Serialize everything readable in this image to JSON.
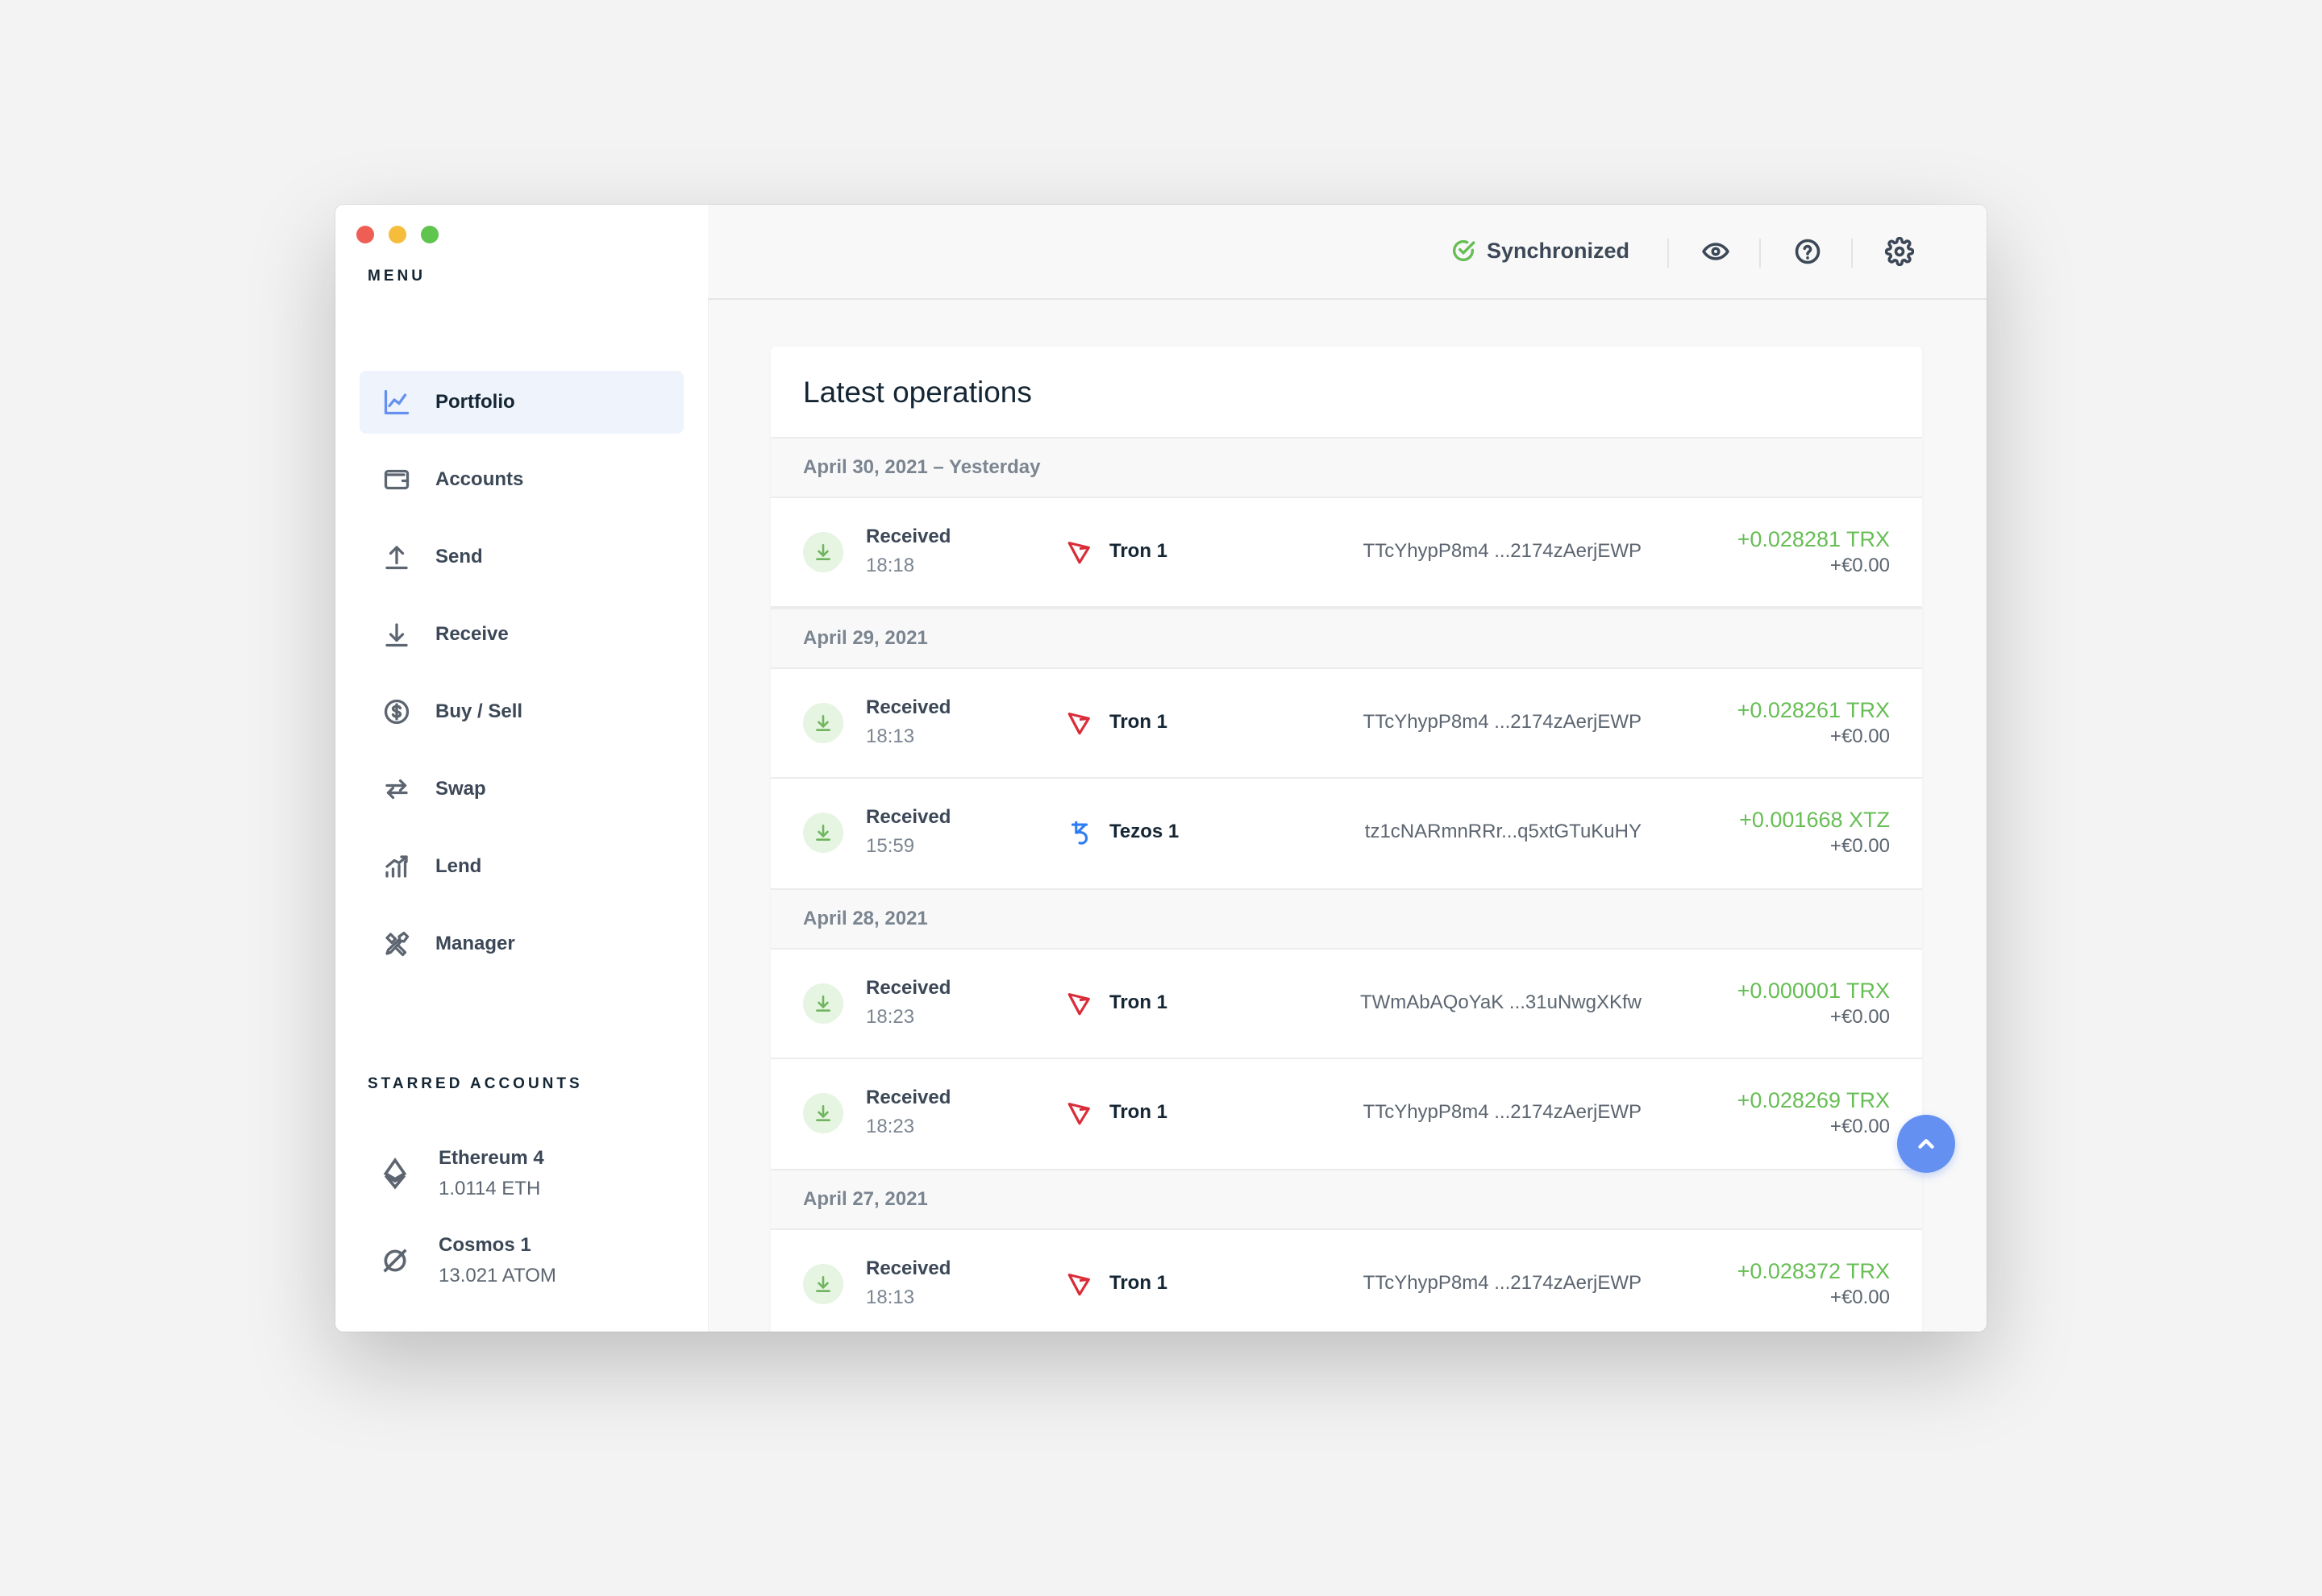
{
  "sidebar": {
    "menu_title": "MENU",
    "items": [
      {
        "label": "Portfolio",
        "icon": "chart-line-icon",
        "active": true
      },
      {
        "label": "Accounts",
        "icon": "wallet-icon"
      },
      {
        "label": "Send",
        "icon": "arrow-up-icon"
      },
      {
        "label": "Receive",
        "icon": "arrow-down-icon"
      },
      {
        "label": "Buy / Sell",
        "icon": "dollar-circle-icon"
      },
      {
        "label": "Swap",
        "icon": "swap-arrows-icon"
      },
      {
        "label": "Lend",
        "icon": "lend-chart-icon"
      },
      {
        "label": "Manager",
        "icon": "tools-icon"
      }
    ],
    "starred_title": "STARRED ACCOUNTS",
    "starred": [
      {
        "name": "Ethereum 4",
        "balance": "1.0114 ETH",
        "icon": "ethereum-icon"
      },
      {
        "name": "Cosmos 1",
        "balance": "13.021 ATOM",
        "icon": "cosmos-icon"
      }
    ]
  },
  "topbar": {
    "status": "Synchronized",
    "status_icon": "check-circle-icon",
    "buttons": [
      "eye-icon",
      "help-icon",
      "settings-icon"
    ]
  },
  "operations": {
    "title": "Latest operations",
    "groups": [
      {
        "date": "April 30, 2021 – Yesterday",
        "ops": [
          {
            "type": "Received",
            "time": "18:18",
            "account": "Tron 1",
            "coin": "tron",
            "address": "TTcYhypP8m4 ...2174zAerjEWP",
            "amount": "+0.028281 TRX",
            "fiat": "+€0.00"
          }
        ]
      },
      {
        "date": "April 29, 2021",
        "ops": [
          {
            "type": "Received",
            "time": "18:13",
            "account": "Tron 1",
            "coin": "tron",
            "address": "TTcYhypP8m4 ...2174zAerjEWP",
            "amount": "+0.028261 TRX",
            "fiat": "+€0.00"
          },
          {
            "type": "Received",
            "time": "15:59",
            "account": "Tezos 1",
            "coin": "tezos",
            "address": "tz1cNARmnRRr...q5xtGTuKuHY",
            "amount": "+0.001668 XTZ",
            "fiat": "+€0.00"
          }
        ]
      },
      {
        "date": "April 28, 2021",
        "ops": [
          {
            "type": "Received",
            "time": "18:23",
            "account": "Tron 1",
            "coin": "tron",
            "address": "TWmAbAQoYaK ...31uNwgXKfw",
            "amount": "+0.000001 TRX",
            "fiat": "+€0.00"
          },
          {
            "type": "Received",
            "time": "18:23",
            "account": "Tron 1",
            "coin": "tron",
            "address": "TTcYhypP8m4 ...2174zAerjEWP",
            "amount": "+0.028269 TRX",
            "fiat": "+€0.00"
          }
        ]
      },
      {
        "date": "April 27, 2021",
        "ops": [
          {
            "type": "Received",
            "time": "18:13",
            "account": "Tron 1",
            "coin": "tron",
            "address": "TTcYhypP8m4 ...2174zAerjEWP",
            "amount": "+0.028372 TRX",
            "fiat": "+€0.00"
          }
        ]
      }
    ]
  },
  "colors": {
    "accent": "#6490f1",
    "positive": "#66be54",
    "tron": "#d92e3a",
    "tezos": "#2c7df7"
  }
}
